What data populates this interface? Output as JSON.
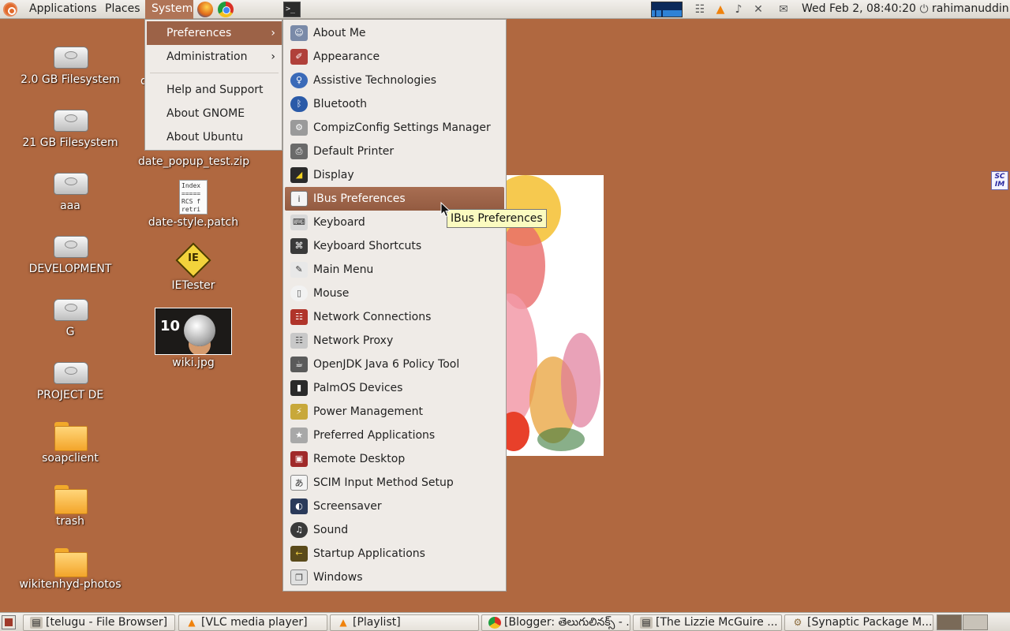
{
  "top_panel": {
    "menus": {
      "applications": "Applications",
      "places": "Places",
      "system": "System"
    },
    "clock": "Wed Feb  2, 08:40:20",
    "username": "rahimanuddin",
    "terminal_glyph": ">_"
  },
  "system_menu": {
    "items": [
      "Preferences",
      "Administration",
      "Help and Support",
      "About GNOME",
      "About Ubuntu"
    ],
    "arrow": "›"
  },
  "preferences_menu": {
    "items": [
      "About Me",
      "Appearance",
      "Assistive Technologies",
      "Bluetooth",
      "CompizConfig Settings Manager",
      "Default Printer",
      "Display",
      "IBus Preferences",
      "Keyboard",
      "Keyboard Shortcuts",
      "Main Menu",
      "Mouse",
      "Network Connections",
      "Network Proxy",
      "OpenJDK Java 6 Policy Tool",
      "PalmOS Devices",
      "Power Management",
      "Preferred Applications",
      "Remote Desktop",
      "SCIM Input Method Setup",
      "Screensaver",
      "Sound",
      "Startup Applications",
      "Windows"
    ],
    "highlighted": "IBus Preferences"
  },
  "tooltip": "IBus Preferences",
  "desktop": {
    "column1": [
      "2.0 GB Filesystem",
      "21 GB Filesystem",
      "aaa",
      "DEVELOPMENT",
      "G",
      "PROJECT DE",
      "soapclient",
      "trash",
      "wikitenhyd-photos"
    ],
    "column2": [
      "date_popup_test.zip",
      "date-style.patch",
      "IETester",
      "wiki.jpg"
    ],
    "partial_label": "d",
    "patch_preview": "Index\n=====\nRCS f\nretri",
    "ietester_text": "IE"
  },
  "scim_indicator": "SC\nIM",
  "taskbar": {
    "tasks": [
      "[telugu - File Browser]",
      "[VLC media player]",
      "[Playlist]",
      "[Blogger: తెలుగులినక్స్ - ...",
      "[The Lizzie McGuire ...",
      "[Synaptic Package M..."
    ]
  },
  "colors": {
    "desktop": "#b06840",
    "menu_bg": "#efebe7",
    "highlight": "#9c6247",
    "tooltip_bg": "#fbfbc0"
  }
}
